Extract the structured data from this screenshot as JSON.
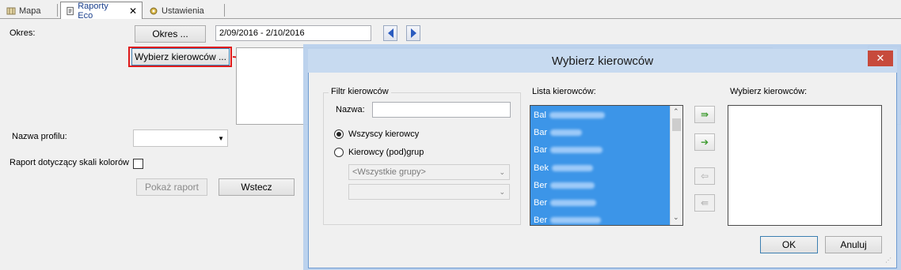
{
  "tabs": [
    {
      "label": "Mapa"
    },
    {
      "label": "Raporty Eco",
      "close": "✕"
    },
    {
      "label": "Ustawienia"
    }
  ],
  "form": {
    "okres_label": "Okres:",
    "okres_button": "Okres ...",
    "date_range": "2/09/2016 - 2/10/2016",
    "choose_drivers_button": "Wybierz kierowców ...",
    "profile_label": "Nazwa profilu:",
    "profile_value": "",
    "color_scale_label": "Raport dotyczący skali kolorów",
    "show_report_button": "Pokaż raport",
    "back_button": "Wstecz"
  },
  "dialog": {
    "title": "Wybierz kierowców",
    "close": "✕",
    "filter_group_label": "Filtr kierowców",
    "name_label": "Nazwa:",
    "name_value": "",
    "all_drivers_label": "Wszyscy kierowcy",
    "subgroup_drivers_label": "Kierowcy (pod)grup",
    "all_groups_select": "<Wszystkie grupy>",
    "second_select": "",
    "driver_list_label": "Lista kierowców:",
    "drivers": [
      {
        "name": "Bal"
      },
      {
        "name": "Bar"
      },
      {
        "name": "Bar"
      },
      {
        "name": "Bek"
      },
      {
        "name": "Ber"
      },
      {
        "name": "Ber"
      },
      {
        "name": "Ber"
      }
    ],
    "selected_label": "Wybierz kierowców:",
    "ok_button": "OK",
    "cancel_button": "Anuluj"
  },
  "colors": {
    "accent_red": "#e01b1b",
    "list_selection": "#3c95e8",
    "nav_blue": "#2a5bbf"
  }
}
